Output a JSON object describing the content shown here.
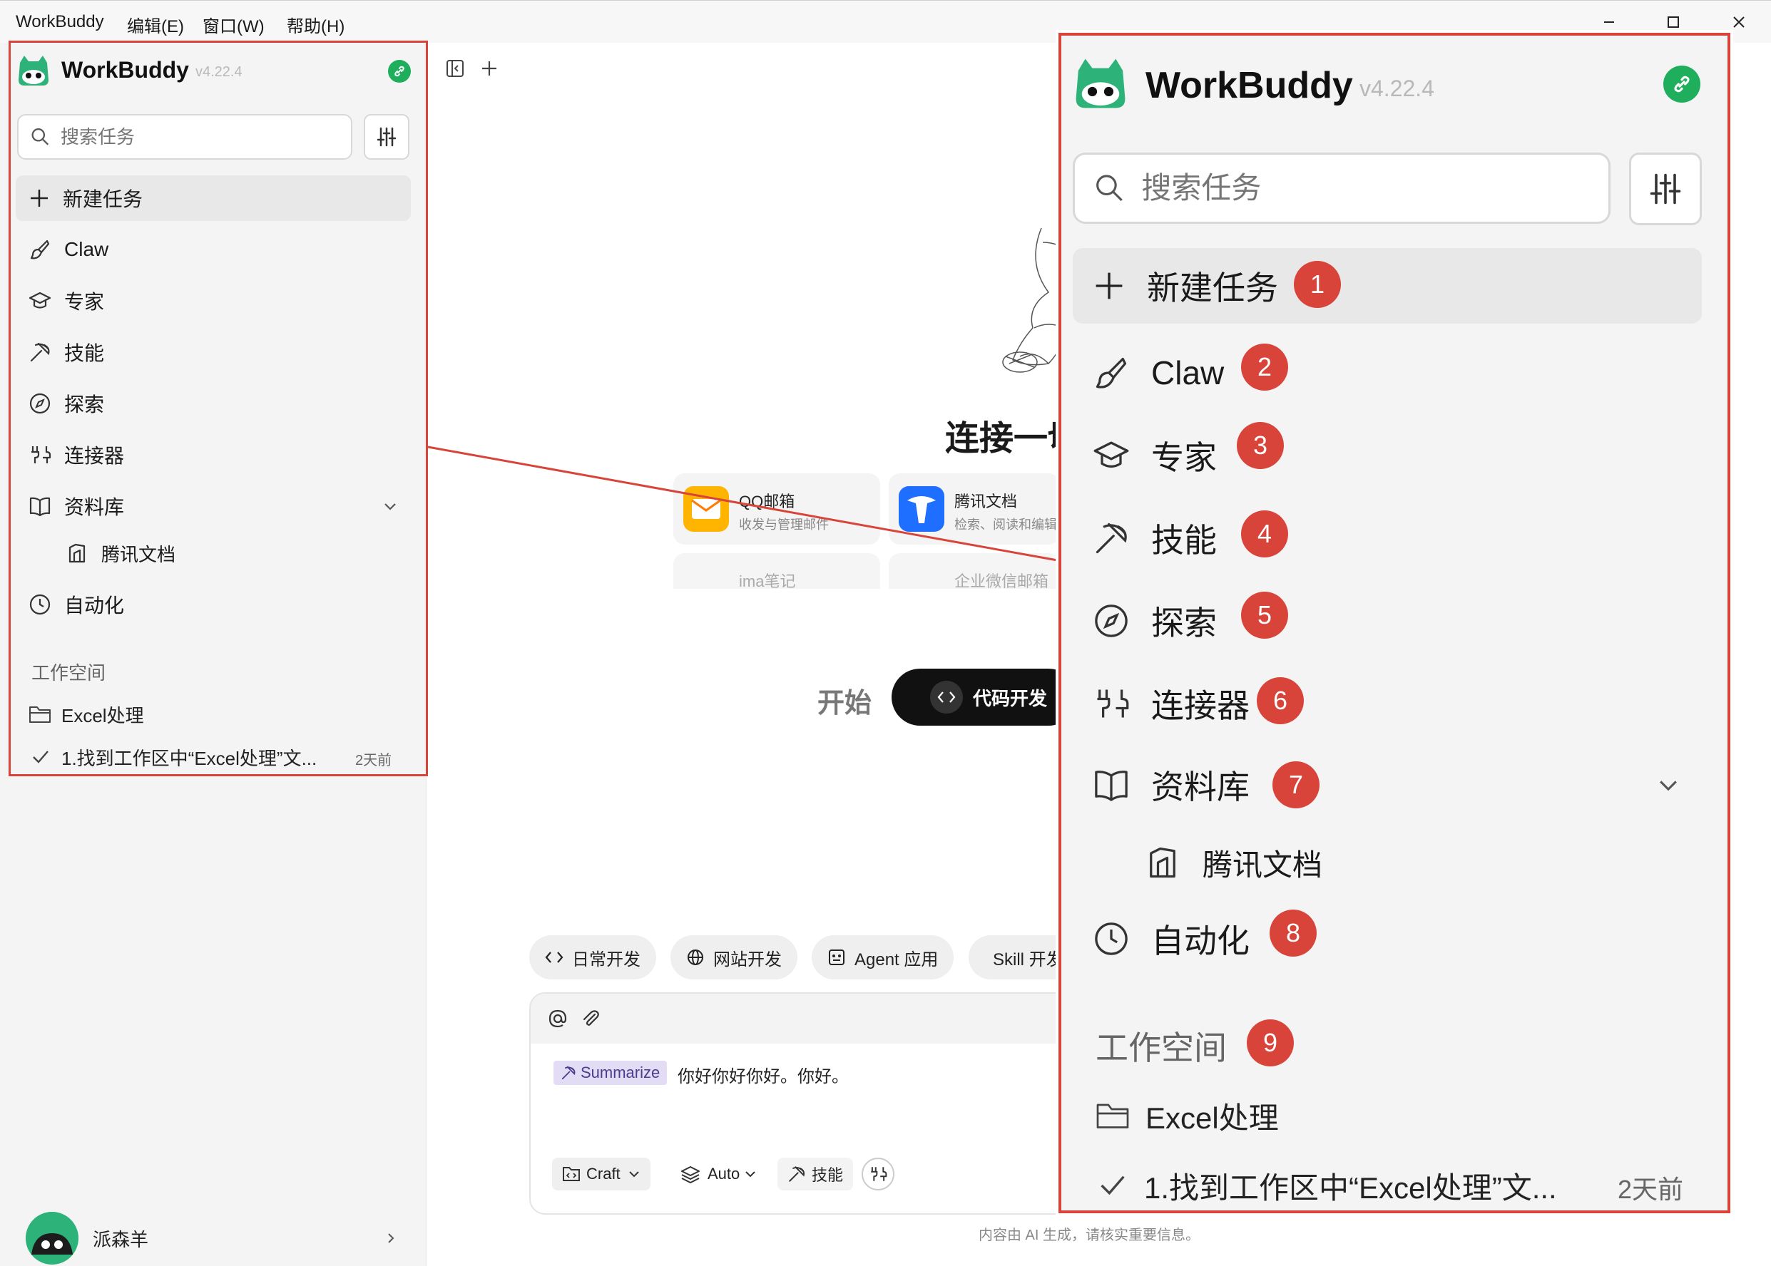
{
  "menu": {
    "items": [
      "WorkBuddy",
      "编辑(E)",
      "窗口(W)",
      "帮助(H)"
    ]
  },
  "app": {
    "name": "WorkBuddy",
    "version": "v4.22.4",
    "brand_color": "#2db37a",
    "link_badge_color": "#1fae5b",
    "annotation_color": "#d9443a"
  },
  "sidebar": {
    "search_placeholder": "搜索任务",
    "nav": [
      {
        "label": "新建任务",
        "icon": "plus-icon"
      },
      {
        "label": "Claw",
        "icon": "brush-icon"
      },
      {
        "label": "专家",
        "icon": "graduation-cap-icon"
      },
      {
        "label": "技能",
        "icon": "pickaxe-icon"
      },
      {
        "label": "探索",
        "icon": "compass-icon"
      },
      {
        "label": "连接器",
        "icon": "plug-icon"
      },
      {
        "label": "资料库",
        "icon": "book-icon"
      },
      {
        "label": "腾讯文档",
        "icon": "doc-icon"
      },
      {
        "label": "自动化",
        "icon": "clock-icon"
      }
    ],
    "workspace_label": "工作空间",
    "workspace_folder": "Excel处理",
    "task_title": "1.找到工作区中“Excel处理”文...",
    "task_time": "2天前",
    "user_name": "派森羊"
  },
  "main": {
    "heading": "连接一切",
    "cards": [
      {
        "title": "QQ邮箱",
        "desc": "收发与管理邮件"
      },
      {
        "title": "腾讯文档",
        "desc": "检索、阅读和编辑"
      },
      {
        "title": "ima笔记",
        "desc": ""
      },
      {
        "title": "企业微信邮箱",
        "desc": ""
      }
    ],
    "start_label": "开始",
    "code_pill": "代码开发",
    "chips": [
      "日常开发",
      "网站开发",
      "Agent 应用",
      "Skill 开发"
    ],
    "skill_tag": "Summarize",
    "input_text": "你好你好你好。你好。",
    "mode_label": "Craft",
    "model_label": "Auto",
    "skills_label": "技能",
    "disclaimer": "内容由 AI 生成，请核实重要信息。"
  },
  "badges": [
    "1",
    "2",
    "3",
    "4",
    "5",
    "6",
    "7",
    "8",
    "9"
  ]
}
